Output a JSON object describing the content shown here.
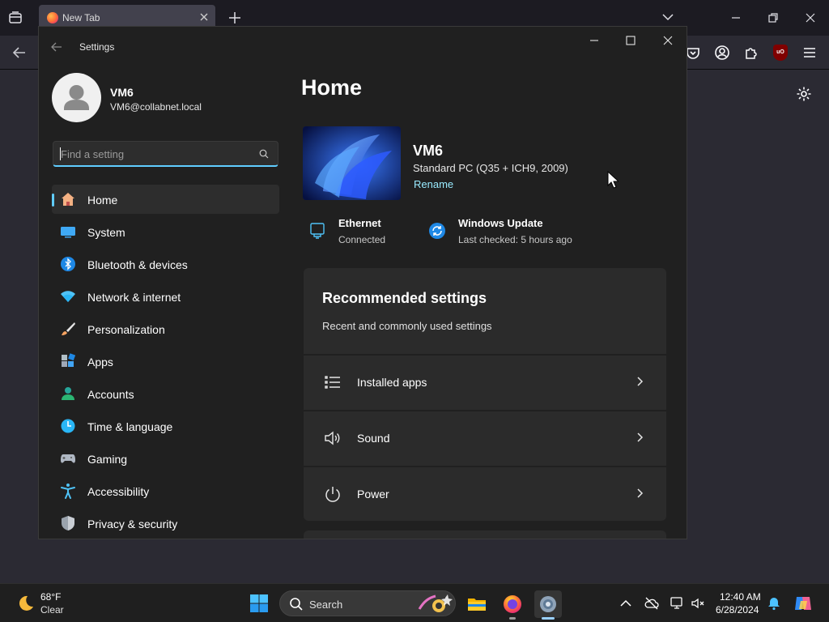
{
  "browser": {
    "tab_title": "New Tab"
  },
  "settings": {
    "window_title": "Settings",
    "profile": {
      "name": "VM6",
      "email": "VM6@collabnet.local"
    },
    "search": {
      "placeholder": "Find a setting"
    },
    "nav": [
      {
        "label": "Home",
        "icon": "home-icon",
        "active": true
      },
      {
        "label": "System",
        "icon": "system-icon"
      },
      {
        "label": "Bluetooth & devices",
        "icon": "bluetooth-icon"
      },
      {
        "label": "Network & internet",
        "icon": "wifi-icon"
      },
      {
        "label": "Personalization",
        "icon": "brush-icon"
      },
      {
        "label": "Apps",
        "icon": "apps-icon"
      },
      {
        "label": "Accounts",
        "icon": "accounts-icon"
      },
      {
        "label": "Time & language",
        "icon": "globe-clock-icon"
      },
      {
        "label": "Gaming",
        "icon": "gamepad-icon"
      },
      {
        "label": "Accessibility",
        "icon": "accessibility-icon"
      },
      {
        "label": "Privacy & security",
        "icon": "shield-icon"
      }
    ],
    "page_title": "Home",
    "device": {
      "name": "VM6",
      "spec": "Standard PC (Q35 + ICH9, 2009)",
      "rename": "Rename"
    },
    "status": [
      {
        "title": "Ethernet",
        "sub": "Connected",
        "icon": "ethernet-icon"
      },
      {
        "title": "Windows Update",
        "sub": "Last checked: 5 hours ago",
        "icon": "update-icon"
      }
    ],
    "recommended": {
      "title": "Recommended settings",
      "subtitle": "Recent and commonly used settings",
      "items": [
        {
          "label": "Installed apps",
          "icon": "list-icon"
        },
        {
          "label": "Sound",
          "icon": "speaker-icon"
        },
        {
          "label": "Power",
          "icon": "power-icon"
        }
      ]
    }
  },
  "taskbar": {
    "weather": {
      "temp": "68°F",
      "condition": "Clear"
    },
    "search_label": "Search",
    "clock": {
      "time": "12:40 AM",
      "date": "6/28/2024"
    }
  },
  "colors": {
    "accent": "#60cdff",
    "link": "#99ebff",
    "window_bg": "#202020",
    "card_bg": "#2b2b2b"
  }
}
